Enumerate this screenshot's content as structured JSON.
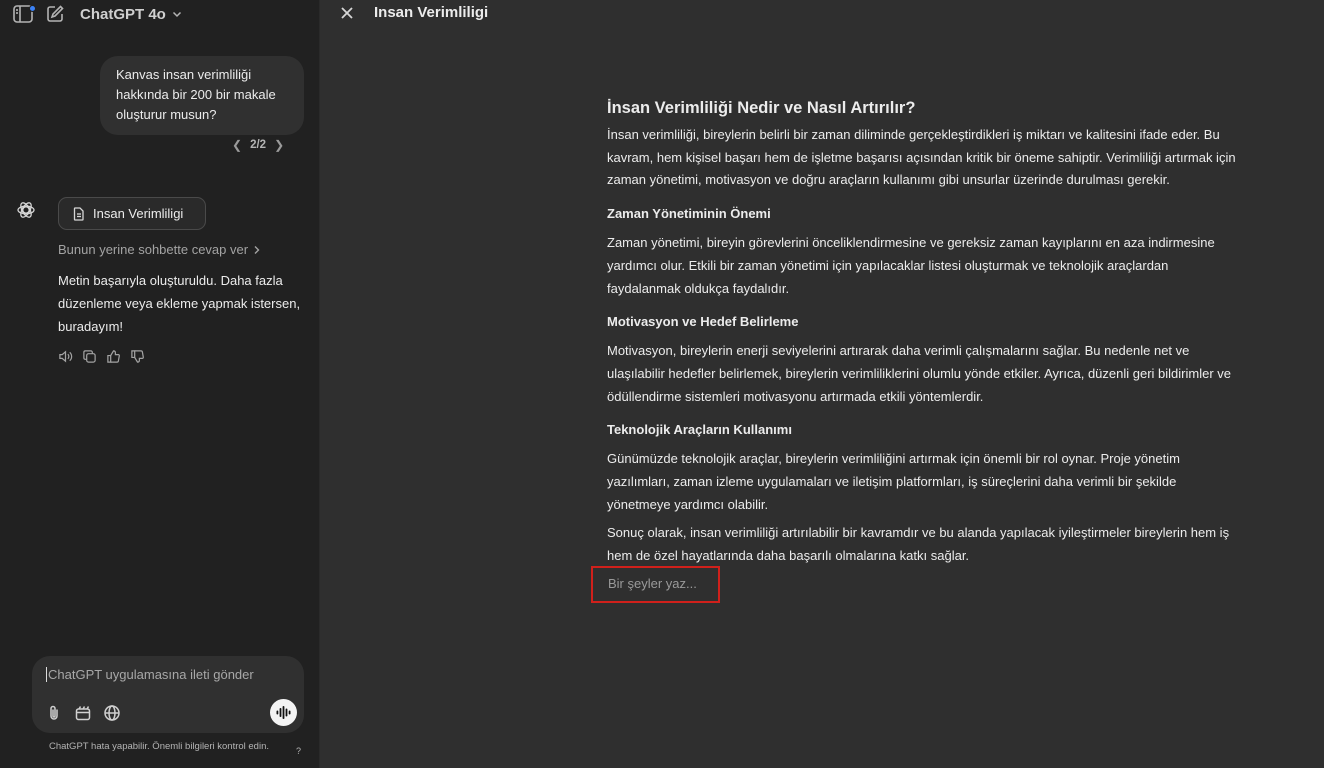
{
  "header": {
    "model_name": "ChatGPT 4o"
  },
  "conversation": {
    "user_message": "Kanvas insan verimliliği hakkında bir 200 bir makale oluşturur musun?",
    "pager": "2/2",
    "canvas_chip_label": "Insan Verimliligi",
    "alt_link": "Bunun yerine sohbette cevap ver",
    "assistant_message": "Metin başarıyla oluşturuldu. Daha fazla düzenleme veya ekleme yapmak istersen, buradayım!"
  },
  "composer": {
    "placeholder": "ChatGPT uygulamasına ileti gönder",
    "disclaimer": "ChatGPT hata yapabilir. Önemli bilgileri kontrol edin.",
    "help": "?"
  },
  "canvas": {
    "title": "Insan Verimliligi",
    "doc_title": "İnsan Verimliliği Nedir ve Nasıl Artırılır?",
    "intro": "İnsan verimliliği, bireylerin belirli bir zaman diliminde gerçekleştirdikleri iş miktarı ve kalitesini ifade eder. Bu kavram, hem kişisel başarı hem de işletme başarısı açısından kritik bir öneme sahiptir. Verimliliği artırmak için zaman yönetimi, motivasyon ve doğru araçların kullanımı gibi unsurlar üzerinde durulması gerekir.",
    "sections": [
      {
        "heading": "Zaman Yönetiminin Önemi",
        "body": "Zaman yönetimi, bireyin görevlerini önceliklendirmesine ve gereksiz zaman kayıplarını en aza indirmesine yardımcı olur. Etkili bir zaman yönetimi için yapılacaklar listesi oluşturmak ve teknolojik araçlardan faydalanmak oldukça faydalıdır."
      },
      {
        "heading": "Motivasyon ve Hedef Belirleme",
        "body": "Motivasyon, bireylerin enerji seviyelerini artırarak daha verimli çalışmalarını sağlar. Bu nedenle net ve ulaşılabilir hedefler belirlemek, bireylerin verimliliklerini olumlu yönde etkiler. Ayrıca, düzenli geri bildirimler ve ödüllendirme sistemleri motivasyonu artırmada etkili yöntemlerdir."
      },
      {
        "heading": "Teknolojik Araçların Kullanımı",
        "body": "Günümüzde teknolojik araçlar, bireylerin verimliliğini artırmak için önemli bir rol oynar. Proje yönetim yazılımları, zaman izleme uygulamaları ve iletişim platformları, iş süreçlerini daha verimli bir şekilde yönetmeye yardımcı olabilir."
      }
    ],
    "conclusion": "Sonuç olarak, insan verimliliği artırılabilir bir kavramdır ve bu alanda yapılacak iyileştirmeler bireylerin hem iş hem de özel hayatlarında daha başarılı olmalarına katkı sağlar.",
    "write_placeholder": "Bir şeyler yaz..."
  },
  "colors": {
    "left_bg": "#212121",
    "right_bg": "#2f2f2f",
    "bubble_bg": "#303030",
    "highlight_border": "#d0201b",
    "notification_dot": "#3b82f6"
  },
  "icons": [
    "sidebar-icon",
    "new-chat-icon",
    "chevron-down-icon",
    "chatgpt-logo-icon",
    "document-icon",
    "chevron-right-icon",
    "speaker-icon",
    "copy-icon",
    "thumbs-up-icon",
    "thumbs-down-icon",
    "paperclip-icon",
    "tools-icon",
    "globe-icon",
    "voice-icon",
    "close-icon"
  ]
}
